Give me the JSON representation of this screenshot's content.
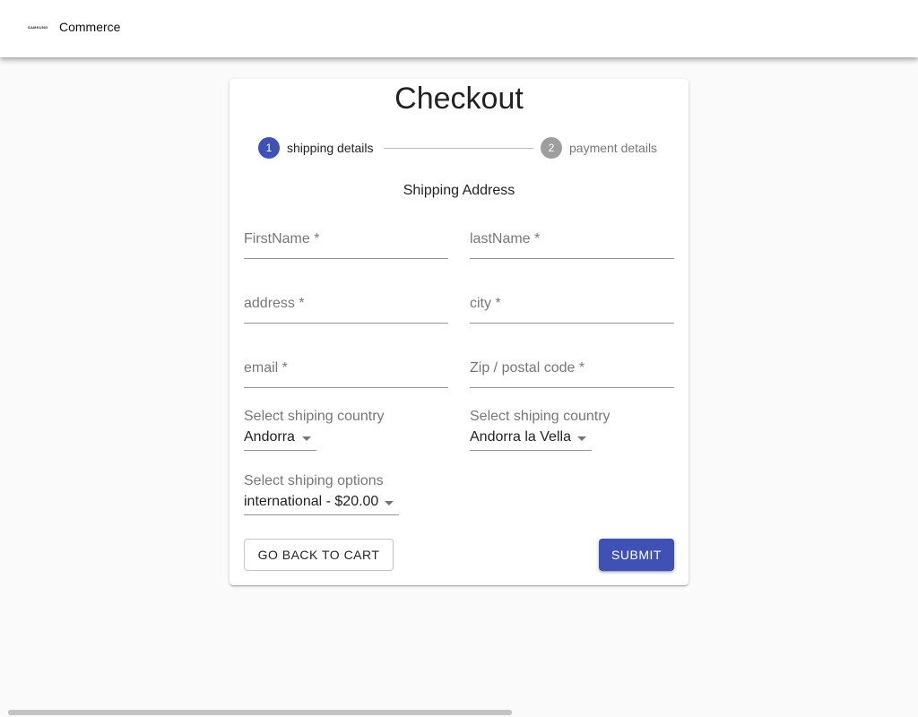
{
  "header": {
    "logo_text": "SAMSUNG",
    "brand": "Commerce"
  },
  "checkout": {
    "title": "Checkout",
    "steps": [
      {
        "number": "1",
        "label": "shipping details",
        "state": "active"
      },
      {
        "number": "2",
        "label": "payment details",
        "state": "inactive"
      }
    ],
    "section_title": "Shipping Address",
    "fields": {
      "first_name": {
        "label": "FirstName *",
        "value": ""
      },
      "last_name": {
        "label": "lastName *",
        "value": ""
      },
      "address": {
        "label": "address *",
        "value": ""
      },
      "city": {
        "label": "city *",
        "value": ""
      },
      "email": {
        "label": "email *",
        "value": ""
      },
      "zip": {
        "label": "Zip / postal code *",
        "value": ""
      }
    },
    "selects": {
      "country": {
        "label": "Select shiping country",
        "value": "Andorra"
      },
      "city": {
        "label": "Select shiping country",
        "value": "Andorra la Vella"
      },
      "shipping_option": {
        "label": "Select shiping options",
        "value": "international - $20.00"
      }
    },
    "buttons": {
      "back": "GO BACK TO CART",
      "submit": "SUBMIT"
    }
  },
  "colors": {
    "primary": "#3f51b5",
    "inactive_step": "#9e9e9e"
  }
}
